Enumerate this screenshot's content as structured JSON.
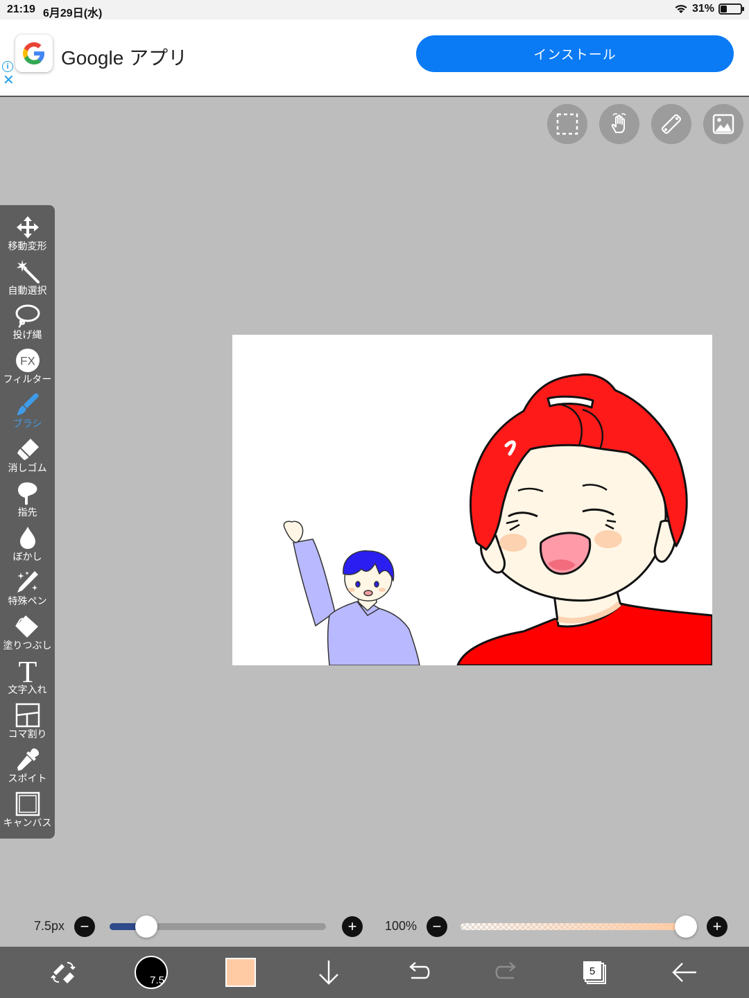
{
  "status_bar": {
    "time": "21:19",
    "date": "6月29日(水)",
    "battery_text": "31%",
    "battery_level": 0.31
  },
  "ad": {
    "app_title": "Google アプリ",
    "install_label": "インストール",
    "info_icon": "info-icon",
    "close_icon": "close-icon"
  },
  "top_tools": [
    {
      "name": "selection-icon"
    },
    {
      "name": "hand-icon"
    },
    {
      "name": "ruler-icon"
    },
    {
      "name": "material-icon"
    }
  ],
  "toolbar": {
    "active_color": "#3f9be8",
    "tools": [
      {
        "label": "移動変形",
        "icon": "move-icon"
      },
      {
        "label": "自動選択",
        "icon": "magic-wand-icon"
      },
      {
        "label": "投げ縄",
        "icon": "lasso-icon"
      },
      {
        "label": "フィルター",
        "icon": "filter-icon"
      },
      {
        "label": "ブラシ",
        "icon": "brush-icon",
        "active": true
      },
      {
        "label": "消しゴム",
        "icon": "eraser-icon"
      },
      {
        "label": "指先",
        "icon": "finger-icon"
      },
      {
        "label": "ぼかし",
        "icon": "blur-icon"
      },
      {
        "label": "特殊ペン",
        "icon": "special-pen-icon"
      },
      {
        "label": "塗りつぶし",
        "icon": "fill-icon"
      },
      {
        "label": "文字入れ",
        "icon": "text-icon"
      },
      {
        "label": "コマ割り",
        "icon": "frame-divider-icon"
      },
      {
        "label": "スポイト",
        "icon": "eyedropper-icon"
      },
      {
        "label": "キャンバス",
        "icon": "canvas-icon"
      }
    ],
    "filter_glyph": "FX",
    "text_glyph": "T"
  },
  "brush_size": {
    "label": "7.5px",
    "value": 7.5,
    "fraction": 0.17
  },
  "opacity": {
    "label": "100%",
    "value": 100,
    "fraction": 1.0
  },
  "bottom_bar": {
    "brush_size_badge": "7.5",
    "current_color": "#ffcba4",
    "layer_count": "5"
  },
  "colors": {
    "hair_red": "#ff1a1a",
    "shirt_red": "#ff0000",
    "hair_blue": "#2a1ef0",
    "sweater": "#b9b9ff",
    "skin": "#fff6e6",
    "blush": "#fcd2b0"
  }
}
